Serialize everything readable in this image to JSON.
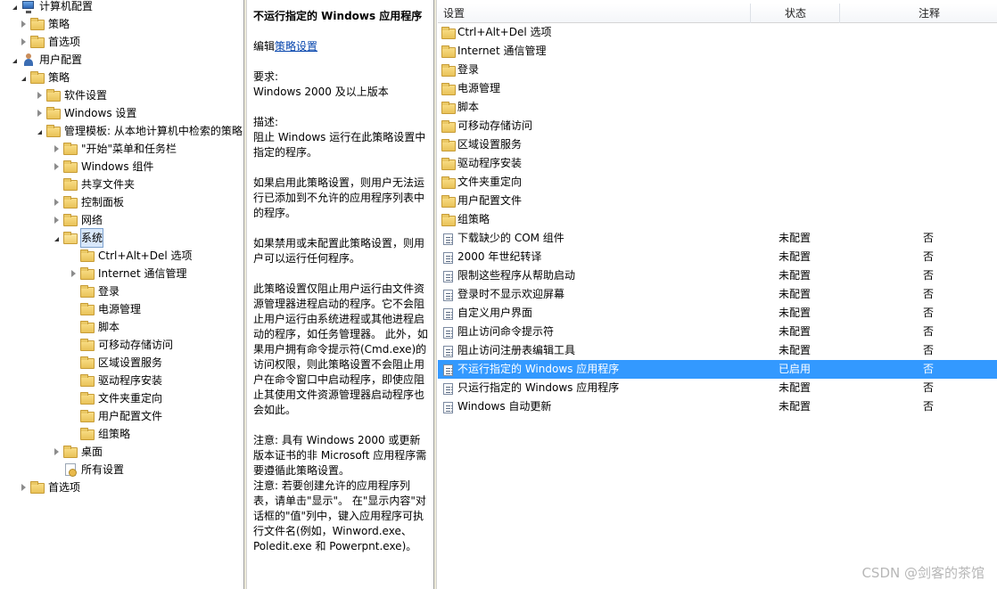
{
  "tree": {
    "items": [
      {
        "label": "计算机配置",
        "icon": "computer-icon",
        "expander": "open"
      },
      {
        "label": "策略",
        "icon": "folder-icon",
        "expander": "closed"
      },
      {
        "label": "首选项",
        "icon": "folder-icon",
        "expander": "closed"
      },
      {
        "label": "用户配置",
        "icon": "user-icon",
        "expander": "open"
      },
      {
        "label": "策略",
        "icon": "folder-icon",
        "expander": "open"
      },
      {
        "label": "软件设置",
        "icon": "folder-icon",
        "expander": "closed"
      },
      {
        "label": "Windows 设置",
        "icon": "folder-icon",
        "expander": "closed"
      },
      {
        "label": "管理模板: 从本地计算机中检索的策略",
        "icon": "folder-icon",
        "expander": "open"
      },
      {
        "label": "\"开始\"菜单和任务栏",
        "icon": "folder-icon",
        "expander": "closed"
      },
      {
        "label": "Windows 组件",
        "icon": "folder-icon",
        "expander": "closed"
      },
      {
        "label": "共享文件夹",
        "icon": "folder-icon",
        "expander": "none"
      },
      {
        "label": "控制面板",
        "icon": "folder-icon",
        "expander": "closed"
      },
      {
        "label": "网络",
        "icon": "folder-icon",
        "expander": "closed"
      },
      {
        "label": "系统",
        "icon": "folder-open-icon",
        "expander": "open",
        "selected": true
      },
      {
        "label": "Ctrl+Alt+Del 选项",
        "icon": "folder-icon",
        "expander": "none"
      },
      {
        "label": "Internet 通信管理",
        "icon": "folder-icon",
        "expander": "closed"
      },
      {
        "label": "登录",
        "icon": "folder-icon",
        "expander": "none"
      },
      {
        "label": "电源管理",
        "icon": "folder-icon",
        "expander": "none"
      },
      {
        "label": "脚本",
        "icon": "folder-icon",
        "expander": "none"
      },
      {
        "label": "可移动存储访问",
        "icon": "folder-icon",
        "expander": "none"
      },
      {
        "label": "区域设置服务",
        "icon": "folder-icon",
        "expander": "none"
      },
      {
        "label": "驱动程序安装",
        "icon": "folder-icon",
        "expander": "none"
      },
      {
        "label": "文件夹重定向",
        "icon": "folder-icon",
        "expander": "none"
      },
      {
        "label": "用户配置文件",
        "icon": "folder-icon",
        "expander": "none"
      },
      {
        "label": "组策略",
        "icon": "folder-icon",
        "expander": "none"
      },
      {
        "label": "桌面",
        "icon": "folder-icon",
        "expander": "closed"
      },
      {
        "label": "所有设置",
        "icon": "all-settings-icon",
        "expander": "none"
      },
      {
        "label": "首选项",
        "icon": "folder-icon",
        "expander": "closed"
      }
    ]
  },
  "description": {
    "title": "不运行指定的 Windows 应用程序",
    "edit_prefix": "编辑",
    "edit_link": "策略设置",
    "requirements_label": "要求:",
    "requirements": "Windows 2000 及以上版本",
    "description_label": "描述:",
    "para1": "阻止 Windows 运行在此策略设置中指定的程序。",
    "para2": "如果启用此策略设置，则用户无法运行已添加到不允许的应用程序列表中的程序。",
    "para3": "如果禁用或未配置此策略设置，则用户可以运行任何程序。",
    "para4": "此策略设置仅阻止用户运行由文件资源管理器进程启动的程序。它不会阻止用户运行由系统进程或其他进程启动的程序，如任务管理器。 此外，如果用户拥有命令提示符(Cmd.exe)的访问权限，则此策略设置不会阻止用户在命令窗口中启动程序，即使应阻止其使用文件资源管理器启动程序也会如此。",
    "note1": "注意: 具有 Windows 2000 或更新版本证书的非 Microsoft 应用程序需要遵循此策略设置。",
    "note2": "注意: 若要创建允许的应用程序列表，请单击\"显示\"。 在\"显示内容\"对话框的\"值\"列中，键入应用程序可执行文件名(例如，Winword.exe、Poledit.exe 和 Powerpnt.exe)。"
  },
  "list": {
    "columns": {
      "setting": "设置",
      "state": "状态",
      "comment": "注释"
    },
    "rows": [
      {
        "name": "Ctrl+Alt+Del 选项",
        "icon": "folder-icon",
        "state": "",
        "comment": ""
      },
      {
        "name": "Internet 通信管理",
        "icon": "folder-icon",
        "state": "",
        "comment": ""
      },
      {
        "name": "登录",
        "icon": "folder-icon",
        "state": "",
        "comment": ""
      },
      {
        "name": "电源管理",
        "icon": "folder-icon",
        "state": "",
        "comment": ""
      },
      {
        "name": "脚本",
        "icon": "folder-icon",
        "state": "",
        "comment": ""
      },
      {
        "name": "可移动存储访问",
        "icon": "folder-icon",
        "state": "",
        "comment": ""
      },
      {
        "name": "区域设置服务",
        "icon": "folder-icon",
        "state": "",
        "comment": ""
      },
      {
        "name": "驱动程序安装",
        "icon": "folder-icon",
        "state": "",
        "comment": ""
      },
      {
        "name": "文件夹重定向",
        "icon": "folder-icon",
        "state": "",
        "comment": ""
      },
      {
        "name": "用户配置文件",
        "icon": "folder-icon",
        "state": "",
        "comment": ""
      },
      {
        "name": "组策略",
        "icon": "folder-icon",
        "state": "",
        "comment": ""
      },
      {
        "name": "下载缺少的 COM 组件",
        "icon": "policy-icon",
        "state": "未配置",
        "comment": "否"
      },
      {
        "name": "2000 年世纪转译",
        "icon": "policy-icon",
        "state": "未配置",
        "comment": "否"
      },
      {
        "name": "限制这些程序从帮助启动",
        "icon": "policy-icon",
        "state": "未配置",
        "comment": "否"
      },
      {
        "name": "登录时不显示欢迎屏幕",
        "icon": "policy-icon",
        "state": "未配置",
        "comment": "否"
      },
      {
        "name": "自定义用户界面",
        "icon": "policy-icon",
        "state": "未配置",
        "comment": "否"
      },
      {
        "name": "阻止访问命令提示符",
        "icon": "policy-icon",
        "state": "未配置",
        "comment": "否"
      },
      {
        "name": "阻止访问注册表编辑工具",
        "icon": "policy-icon",
        "state": "未配置",
        "comment": "否"
      },
      {
        "name": "不运行指定的 Windows 应用程序",
        "icon": "policy-icon",
        "state": "已启用",
        "comment": "否",
        "selected": true
      },
      {
        "name": "只运行指定的 Windows 应用程序",
        "icon": "policy-icon",
        "state": "未配置",
        "comment": "否"
      },
      {
        "name": "Windows 自动更新",
        "icon": "policy-icon",
        "state": "未配置",
        "comment": "否"
      }
    ]
  },
  "watermark": "CSDN @剑客的茶馆",
  "colors": {
    "selection": "#3399ff",
    "link": "#0645ad"
  }
}
